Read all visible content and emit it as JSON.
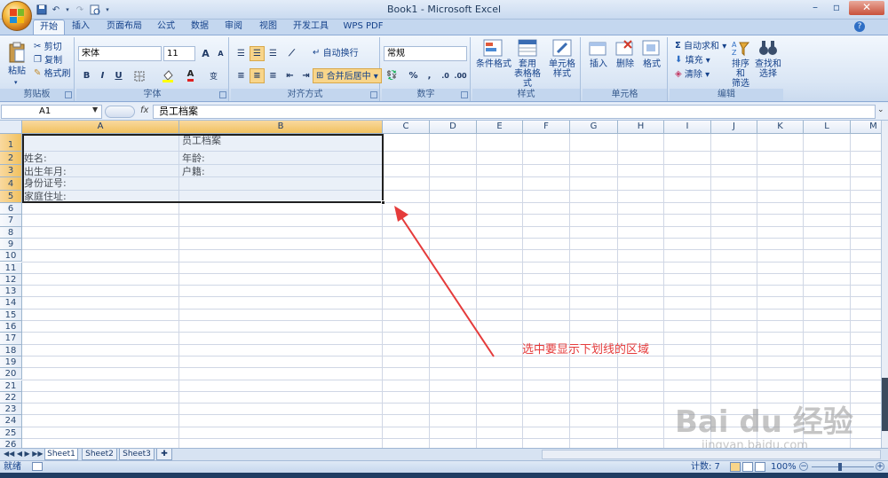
{
  "window": {
    "title": "Book1 - Microsoft Excel"
  },
  "quick_access": {
    "items": [
      "save-icon",
      "undo-icon",
      "redo-icon",
      "print-preview-icon"
    ]
  },
  "tabs": [
    "开始",
    "插入",
    "页面布局",
    "公式",
    "数据",
    "审阅",
    "视图",
    "开发工具",
    "WPS PDF"
  ],
  "active_tab": "开始",
  "ribbon": {
    "clipboard": {
      "label": "剪贴板",
      "paste": "粘贴",
      "cut": "剪切",
      "copy": "复制",
      "format_painter": "格式刷"
    },
    "font": {
      "label": "字体",
      "font_name": "宋体",
      "font_size": "11",
      "bold": "B",
      "italic": "I",
      "underline": "U",
      "grow": "A",
      "shrink": "A",
      "fontcolor_a": "A",
      "wen": "变"
    },
    "alignment": {
      "label": "对齐方式",
      "wrap": "自动换行",
      "merge": "合并后居中"
    },
    "number": {
      "label": "数字",
      "format": "常规",
      "percent": "%",
      "comma": ","
    },
    "styles": {
      "label": "样式",
      "conditional": "条件格式",
      "table": "套用\n表格格式",
      "cell": "单元格\n样式"
    },
    "cells": {
      "label": "单元格",
      "insert": "插入",
      "delete": "删除",
      "format": "格式"
    },
    "editing": {
      "label": "编辑",
      "autosum": "自动求和",
      "fill": "填充",
      "clear": "清除",
      "sort": "排序和\n筛选",
      "find": "查找和\n选择"
    }
  },
  "formula_bar": {
    "name_box": "A1",
    "fx": "fx",
    "content": "员工档案"
  },
  "columns": [
    "A",
    "B",
    "C",
    "D",
    "E",
    "F",
    "G",
    "H",
    "I",
    "J",
    "K",
    "L",
    "M"
  ],
  "rows": [
    "1",
    "2",
    "3",
    "4",
    "5",
    "6",
    "7",
    "8",
    "9",
    "10",
    "11",
    "12",
    "13",
    "14",
    "15",
    "16",
    "17",
    "18",
    "19",
    "20",
    "21",
    "22",
    "23",
    "24",
    "25",
    "26"
  ],
  "cells": {
    "b1": "员工档案",
    "a2": "姓名:",
    "b2": "年龄:",
    "a3": "出生年月:",
    "b3": "户籍:",
    "a4": "身份证号:",
    "a5": "家庭住址:"
  },
  "sheets": [
    "Sheet1",
    "Sheet2",
    "Sheet3"
  ],
  "active_sheet": "Sheet1",
  "status": {
    "ready": "就绪",
    "count": "计数: 7",
    "zoom": "100%"
  },
  "annotation": "选中要显示下划线的区域",
  "watermark": {
    "text": "Bai du 经验",
    "sub": "jingyan.baidu.com"
  },
  "colors": {
    "annotation": "#e53b3b",
    "selection_header": "#f1c15f",
    "ribbon": "#dae6f5"
  }
}
